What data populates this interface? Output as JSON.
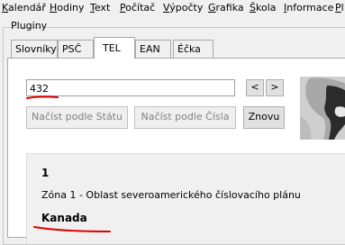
{
  "menu": {
    "items": [
      {
        "label": "Kalendář",
        "hot_index": 0
      },
      {
        "label": "Hodiny",
        "hot_index": 0
      },
      {
        "label": "Text",
        "hot_index": 0
      },
      {
        "label": "Počítač",
        "hot_index": 0
      },
      {
        "label": "Výpočty",
        "hot_index": 0
      },
      {
        "label": "Grafika",
        "hot_index": 0
      },
      {
        "label": "Škola",
        "hot_index": 0
      },
      {
        "label": "Informace",
        "hot_index": 0
      },
      {
        "label": "Pl",
        "hot_index": 0
      }
    ]
  },
  "group": {
    "title": "Pluginy"
  },
  "tabs": [
    {
      "label": "Slovníky",
      "active": false
    },
    {
      "label": "PSČ",
      "active": false
    },
    {
      "label": "TEL",
      "active": true
    },
    {
      "label": "EAN",
      "active": false
    },
    {
      "label": "Éčka",
      "active": false
    }
  ],
  "search": {
    "value": "432"
  },
  "nav": {
    "prev": "<",
    "next": ">"
  },
  "buttons": {
    "by_state": "Načíst podle Státu",
    "by_number": "Načíst podle Čísla",
    "again": "Znovu"
  },
  "result": {
    "number": "1",
    "zone": "Zóna 1 - Oblast severoamerického číslovacího plánu",
    "country": "Kanada"
  },
  "colors": {
    "annotation": "#e00000",
    "map_land": "#2b2b2b",
    "map_sea": "#cfcfcf",
    "disabled_text": "#838383"
  }
}
